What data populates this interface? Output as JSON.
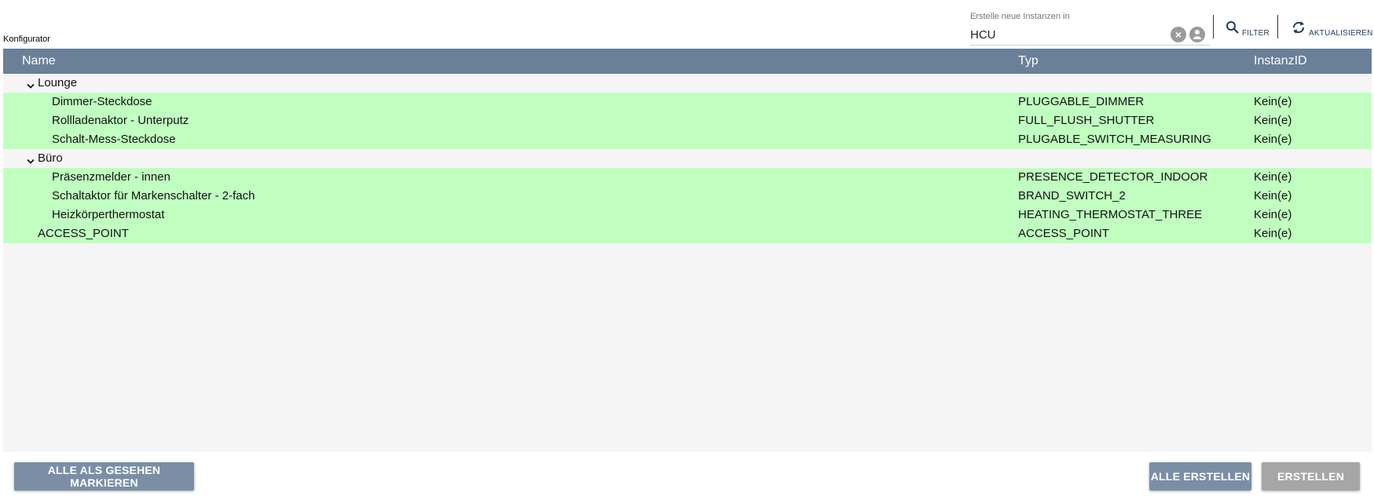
{
  "page": {
    "title": "Konfigurator"
  },
  "target": {
    "label": "Erstelle neue Instanzen in",
    "value": "HCU",
    "clear_icon": "close-circle-icon",
    "dropdown_icon": "chevron-down-icon"
  },
  "toolbar": {
    "filter_label": "FILTER",
    "refresh_label": "AKTUALISIEREN",
    "filter_icon": "search-icon",
    "refresh_icon": "refresh-icon"
  },
  "table": {
    "columns": {
      "name": "Name",
      "type": "Typ",
      "id": "InstanzID"
    },
    "groups": [
      {
        "name": "Lounge",
        "devices": [
          {
            "name": "Dimmer-Steckdose",
            "type": "PLUGGABLE_DIMMER",
            "id": "Kein(e)"
          },
          {
            "name": "Rollladenaktor - Unterputz",
            "type": "FULL_FLUSH_SHUTTER",
            "id": "Kein(e)"
          },
          {
            "name": "Schalt-Mess-Steckdose",
            "type": "PLUGABLE_SWITCH_MEASURING",
            "id": "Kein(e)"
          }
        ]
      },
      {
        "name": "Büro",
        "devices": [
          {
            "name": "Präsenzmelder - innen",
            "type": "PRESENCE_DETECTOR_INDOOR",
            "id": "Kein(e)"
          },
          {
            "name": "Schaltaktor für Markenschalter - 2-fach",
            "type": "BRAND_SWITCH_2",
            "id": "Kein(e)"
          },
          {
            "name": "Heizkörperthermostat",
            "type": "HEATING_THERMOSTAT_THREE",
            "id": "Kein(e)"
          }
        ]
      }
    ],
    "root_items": [
      {
        "name": "ACCESS_POINT",
        "type": "ACCESS_POINT",
        "id": "Kein(e)"
      }
    ]
  },
  "footer": {
    "mark_all_seen": "ALLE ALS GESEHEN MARKIEREN",
    "create_all": "ALLE ERSTELLEN",
    "create": "ERSTELLEN"
  },
  "colors": {
    "header_bg": "#6a7f98",
    "new_row_bg": "#c0ffc0",
    "primary_button": "#7a8fa6",
    "disabled_button": "#a6a6a6"
  }
}
